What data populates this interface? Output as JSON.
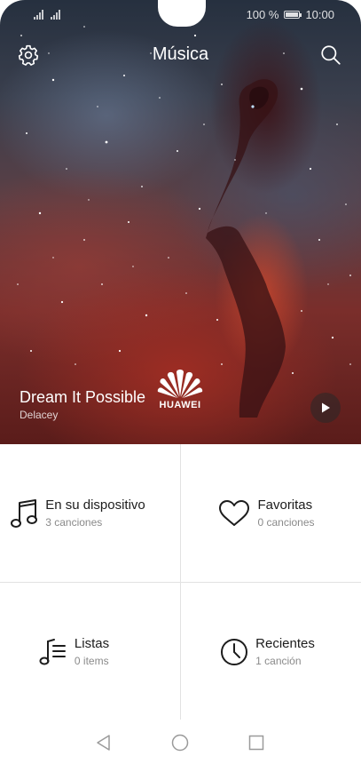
{
  "status_bar": {
    "battery_text": "100 %",
    "time": "10:00"
  },
  "header": {
    "title": "Música",
    "settings_icon": "gear-icon",
    "search_icon": "search-icon"
  },
  "now_playing": {
    "title": "Dream It Possible",
    "artist": "Delacey",
    "brand": "HUAWEI",
    "play_icon": "play-icon"
  },
  "categories": [
    {
      "label": "En su dispositivo",
      "sub": "3 canciones",
      "icon": "music-note-icon"
    },
    {
      "label": "Favoritas",
      "sub": "0 canciones",
      "icon": "heart-icon"
    },
    {
      "label": "Listas",
      "sub": "0 items",
      "icon": "playlist-icon"
    },
    {
      "label": "Recientes",
      "sub": "1 canción",
      "icon": "clock-icon"
    }
  ],
  "nav": {
    "back_icon": "back-triangle-icon",
    "home_icon": "home-circle-icon",
    "recent_icon": "recent-square-icon"
  }
}
